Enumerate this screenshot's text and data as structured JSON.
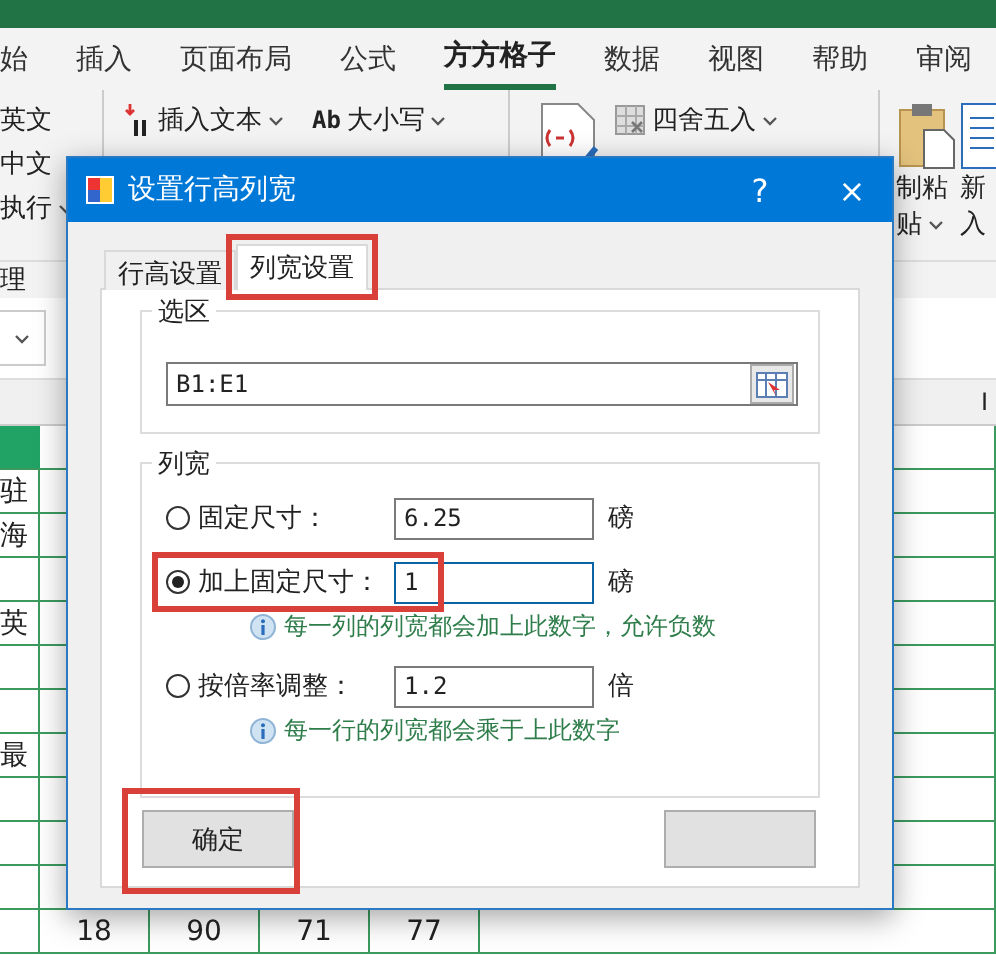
{
  "ribbon_tabs": [
    {
      "label": "始",
      "selected": false
    },
    {
      "label": "插入",
      "selected": false
    },
    {
      "label": "页面布局",
      "selected": false
    },
    {
      "label": "公式",
      "selected": false
    },
    {
      "label": "方方格子",
      "selected": true
    },
    {
      "label": "数据",
      "selected": false
    },
    {
      "label": "视图",
      "selected": false
    },
    {
      "label": "帮助",
      "selected": false
    },
    {
      "label": "审阅",
      "selected": false
    }
  ],
  "ribbon": {
    "left_items": [
      {
        "label": "英文",
        "dropdown": false
      },
      {
        "label": "中文",
        "dropdown": false
      },
      {
        "label": "执行",
        "dropdown": true
      }
    ],
    "group_label": "理",
    "commands": [
      {
        "kind": "insert",
        "label": "插入文本",
        "dropdown": true
      },
      {
        "kind": "case",
        "icon_text": "Ab",
        "label": "大小写",
        "dropdown": true
      },
      {
        "kind": "round",
        "label": "四舍五入",
        "dropdown": true
      }
    ],
    "paste": {
      "line_1": "制粘",
      "line_2": "贴"
    },
    "new": {
      "line_1": "新",
      "line_2": "入"
    }
  },
  "sheet": {
    "column_header": "I",
    "rows": [
      {
        "cells": [
          "驻",
          "",
          "",
          "",
          ""
        ]
      },
      {
        "cells": [
          "海",
          "",
          "",
          "",
          ""
        ]
      },
      {
        "cells": [
          "",
          "",
          "",
          "",
          ""
        ]
      },
      {
        "cells": [
          "英",
          "",
          "",
          "",
          ""
        ]
      },
      {
        "cells": [
          "",
          "",
          "",
          "",
          ""
        ]
      },
      {
        "cells": [
          "",
          "",
          "",
          "",
          ""
        ]
      },
      {
        "cells": [
          "最",
          "",
          "",
          "",
          ""
        ]
      },
      {
        "cells": [
          "",
          "",
          "",
          "",
          ""
        ]
      },
      {
        "cells": [
          "",
          "",
          "",
          "",
          ""
        ]
      },
      {
        "cells": [
          "",
          "",
          "",
          "",
          ""
        ]
      },
      {
        "cells": [
          "",
          "18",
          "90",
          "71",
          "77"
        ]
      }
    ]
  },
  "dialog": {
    "title": "设置行高列宽",
    "help": "?",
    "close": "×",
    "tabs": [
      {
        "label": "行高设置",
        "selected": false,
        "highlighted": false
      },
      {
        "label": "列宽设置",
        "selected": true,
        "highlighted": true
      }
    ],
    "selection_group": {
      "title": "选区",
      "value": "B1:E1"
    },
    "width_group": {
      "title": "列宽",
      "options": [
        {
          "label": "固定尺寸：",
          "value": "6.25",
          "unit": "磅",
          "selected": false,
          "highlighted": false,
          "focused": false
        },
        {
          "label": "加上固定尺寸：",
          "value": "1",
          "unit": "磅",
          "selected": true,
          "highlighted": true,
          "focused": true,
          "hint": "每一列的列宽都会加上此数字，允许负数"
        },
        {
          "label": "按倍率调整：",
          "value": "1.2",
          "unit": "倍",
          "selected": false,
          "highlighted": false,
          "focused": false,
          "hint": "每一行的列宽都会乘于上此数字"
        }
      ]
    },
    "buttons": [
      {
        "label": "确定",
        "highlighted": true
      },
      {
        "highlighted": false
      }
    ]
  }
}
